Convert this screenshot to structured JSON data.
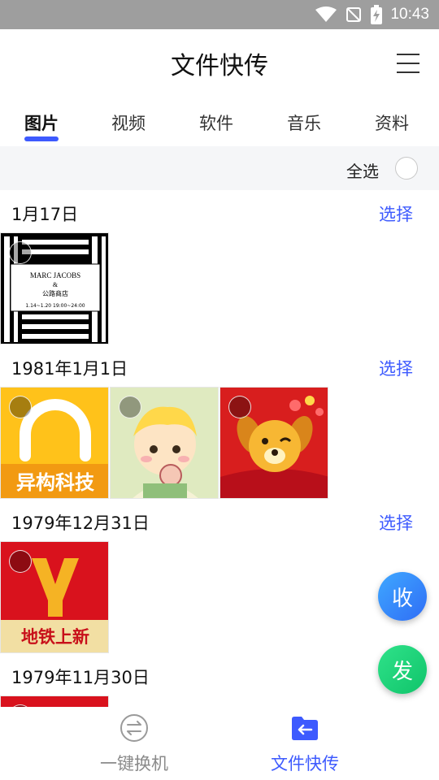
{
  "status_bar": {
    "time": "10:43",
    "icons": [
      "wifi-icon",
      "no-signal-icon",
      "battery-charging-icon"
    ]
  },
  "header": {
    "title": "文件快传",
    "menu_icon": "menu-icon"
  },
  "tabs": [
    {
      "label": "图片",
      "active": true
    },
    {
      "label": "视频",
      "active": false
    },
    {
      "label": "软件",
      "active": false
    },
    {
      "label": "音乐",
      "active": false
    },
    {
      "label": "资料",
      "active": false
    }
  ],
  "select_bar": {
    "select_all_label": "全选"
  },
  "groups": [
    {
      "date": "1月17日",
      "select_label": "选择",
      "images": [
        {
          "text_lines": [
            "MARC JACOBS",
            "&",
            "公路商店",
            "1.14~1.20  19:00~24:00"
          ]
        }
      ]
    },
    {
      "date": "1981年1月1日",
      "select_label": "选择",
      "images": [
        {
          "text": "异构科技"
        },
        {
          "text": ""
        },
        {
          "text": ""
        }
      ]
    },
    {
      "date": "1979年12月31日",
      "select_label": "选择",
      "images": [
        {
          "text": "地铁上新"
        }
      ]
    },
    {
      "date": "1979年11月30日",
      "select_label": "",
      "images": []
    }
  ],
  "fab": {
    "receive_label": "收",
    "send_label": "发"
  },
  "bottom_nav": [
    {
      "label": "一键换机",
      "icon": "swap-icon",
      "active": false
    },
    {
      "label": "文件快传",
      "icon": "folder-transfer-icon",
      "active": true
    }
  ],
  "colors": {
    "accent": "#3d5afe",
    "status_bar": "#9e9e9e",
    "send": "#10c46a",
    "receive": "#2f6df6"
  }
}
